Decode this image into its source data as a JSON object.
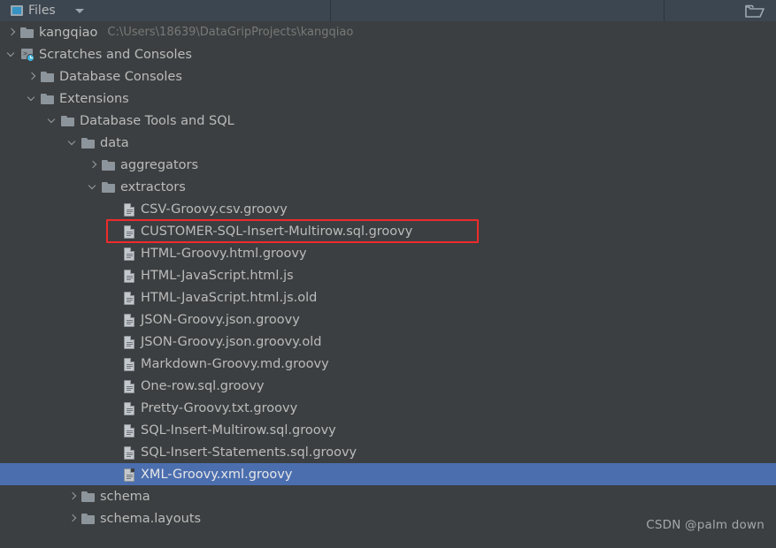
{
  "header": {
    "tab_label": "Files",
    "tab_icon": "files-panel-icon",
    "dropdown_icon": "chevron-down-icon",
    "open_folder_icon": "open-folder-icon"
  },
  "tree": {
    "rows": [
      {
        "label": "kangqiao",
        "sublabel": "C:\\Users\\18639\\DataGripProjects\\kangqiao",
        "indent": 0,
        "arrow": "collapsed",
        "icon": "folder",
        "selected": false
      },
      {
        "label": "Scratches and Consoles",
        "sublabel": "",
        "indent": 0,
        "arrow": "expanded",
        "icon": "scratches",
        "selected": false
      },
      {
        "label": "Database Consoles",
        "sublabel": "",
        "indent": 1,
        "arrow": "collapsed",
        "icon": "folder",
        "selected": false
      },
      {
        "label": "Extensions",
        "sublabel": "",
        "indent": 1,
        "arrow": "expanded",
        "icon": "folder",
        "selected": false
      },
      {
        "label": "Database Tools and SQL",
        "sublabel": "",
        "indent": 2,
        "arrow": "expanded",
        "icon": "folder",
        "selected": false
      },
      {
        "label": "data",
        "sublabel": "",
        "indent": 3,
        "arrow": "expanded",
        "icon": "folder",
        "selected": false
      },
      {
        "label": "aggregators",
        "sublabel": "",
        "indent": 4,
        "arrow": "collapsed",
        "icon": "folder",
        "selected": false
      },
      {
        "label": "extractors",
        "sublabel": "",
        "indent": 4,
        "arrow": "expanded",
        "icon": "folder",
        "selected": false
      },
      {
        "label": "CSV-Groovy.csv.groovy",
        "sublabel": "",
        "indent": 5,
        "arrow": "none",
        "icon": "file",
        "selected": false
      },
      {
        "label": "CUSTOMER-SQL-Insert-Multirow.sql.groovy",
        "sublabel": "",
        "indent": 5,
        "arrow": "none",
        "icon": "file",
        "selected": false
      },
      {
        "label": "HTML-Groovy.html.groovy",
        "sublabel": "",
        "indent": 5,
        "arrow": "none",
        "icon": "file",
        "selected": false
      },
      {
        "label": "HTML-JavaScript.html.js",
        "sublabel": "",
        "indent": 5,
        "arrow": "none",
        "icon": "file",
        "selected": false
      },
      {
        "label": "HTML-JavaScript.html.js.old",
        "sublabel": "",
        "indent": 5,
        "arrow": "none",
        "icon": "file",
        "selected": false
      },
      {
        "label": "JSON-Groovy.json.groovy",
        "sublabel": "",
        "indent": 5,
        "arrow": "none",
        "icon": "file",
        "selected": false
      },
      {
        "label": "JSON-Groovy.json.groovy.old",
        "sublabel": "",
        "indent": 5,
        "arrow": "none",
        "icon": "file",
        "selected": false
      },
      {
        "label": "Markdown-Groovy.md.groovy",
        "sublabel": "",
        "indent": 5,
        "arrow": "none",
        "icon": "file",
        "selected": false
      },
      {
        "label": "One-row.sql.groovy",
        "sublabel": "",
        "indent": 5,
        "arrow": "none",
        "icon": "file",
        "selected": false
      },
      {
        "label": "Pretty-Groovy.txt.groovy",
        "sublabel": "",
        "indent": 5,
        "arrow": "none",
        "icon": "file",
        "selected": false
      },
      {
        "label": "SQL-Insert-Multirow.sql.groovy",
        "sublabel": "",
        "indent": 5,
        "arrow": "none",
        "icon": "file",
        "selected": false
      },
      {
        "label": "SQL-Insert-Statements.sql.groovy",
        "sublabel": "",
        "indent": 5,
        "arrow": "none",
        "icon": "file",
        "selected": false
      },
      {
        "label": "XML-Groovy.xml.groovy",
        "sublabel": "",
        "indent": 5,
        "arrow": "none",
        "icon": "file",
        "selected": true
      },
      {
        "label": "schema",
        "sublabel": "",
        "indent": 3,
        "arrow": "collapsed",
        "icon": "folder",
        "selected": false
      },
      {
        "label": "schema.layouts",
        "sublabel": "",
        "indent": 3,
        "arrow": "collapsed",
        "icon": "folder",
        "selected": false
      }
    ]
  },
  "annotation": {
    "highlight_row_index": 9,
    "color": "#ee2b2b"
  },
  "watermark": {
    "text": "CSDN @palm down"
  },
  "colors": {
    "panel_background": "#3c3f41",
    "header_background": "#3c4650",
    "selection": "#4b6eaf",
    "text": "#bbbbbb",
    "muted_text": "#787878",
    "accent": "#3592c4"
  }
}
